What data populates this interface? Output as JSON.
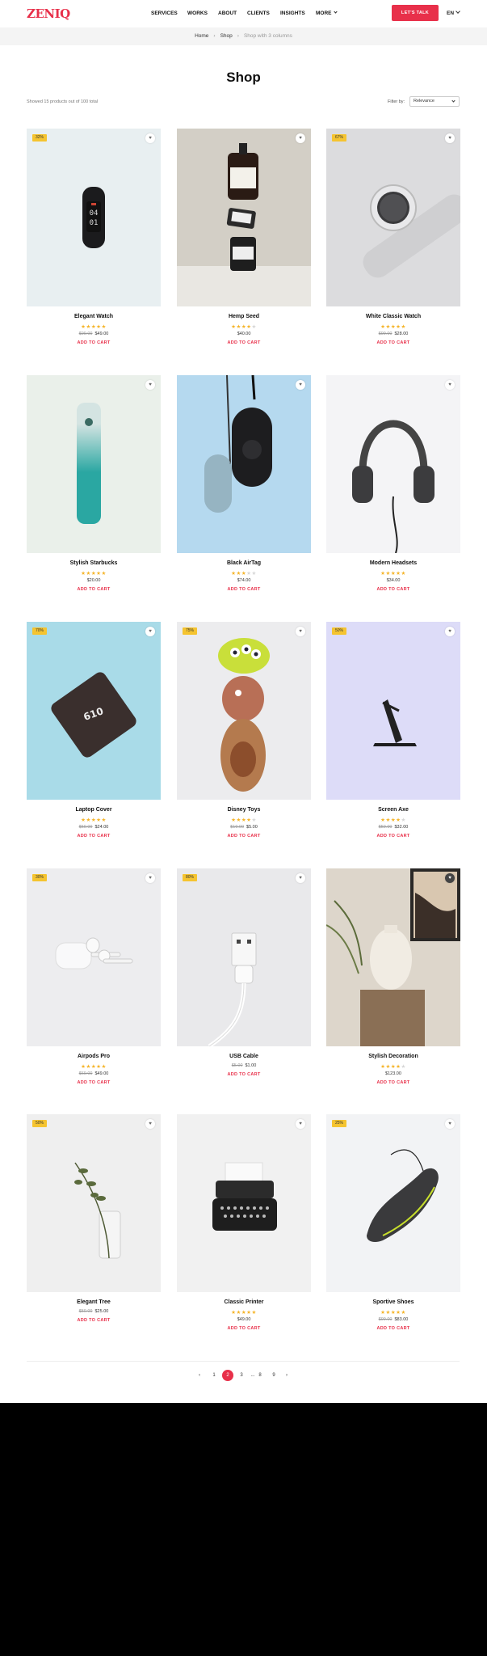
{
  "header": {
    "logo": "ZENIQ",
    "nav": [
      "SERVICES",
      "WORKS",
      "ABOUT",
      "CLIENTS",
      "INSIGHTS",
      "MORE"
    ],
    "cta": "LET'S TALK",
    "lang": "EN"
  },
  "breadcrumb": {
    "home": "Home",
    "shop": "Shop",
    "current": "Shop with 3 columns"
  },
  "page": {
    "title": "Shop",
    "showing": "Showed 15 products out of 100 total",
    "filter_label": "Filter by:",
    "filter_value": "Relevance"
  },
  "products": [
    {
      "name": "Elegant Watch",
      "badge": "32%",
      "rating": 5,
      "old_price": "$99.00",
      "price": "$49.00",
      "cart": "ADD TO CART",
      "bg": "#e8eff1"
    },
    {
      "name": "Hemp Seed",
      "badge": "",
      "rating": 4,
      "old_price": "",
      "price": "$40.00",
      "cart": "ADD TO CART",
      "bg": "#d3cfc6"
    },
    {
      "name": "White Classic Watch",
      "badge": "67%",
      "rating": 5,
      "old_price": "$99.00",
      "price": "$28.00",
      "cart": "ADD TO CART",
      "bg": "#dcdcde"
    },
    {
      "name": "Stylish Starbucks",
      "badge": "",
      "rating": 5,
      "old_price": "",
      "price": "$20.00",
      "cart": "ADD TO CART",
      "bg": "#eaf0ea"
    },
    {
      "name": "Black AirTag",
      "badge": "",
      "rating": 3,
      "old_price": "",
      "price": "$74.00",
      "cart": "ADD TO CART",
      "bg": "#b5d9ef"
    },
    {
      "name": "Modern Headsets",
      "badge": "",
      "rating": 5,
      "old_price": "",
      "price": "$34.00",
      "cart": "ADD TO CART",
      "bg": "#f4f4f6"
    },
    {
      "name": "Laptop Cover",
      "badge": "70%",
      "rating": 5,
      "old_price": "$59.00",
      "price": "$24.00",
      "cart": "ADD TO CART",
      "bg": "#a9dbe8"
    },
    {
      "name": "Disney Toys",
      "badge": "75%",
      "rating": 4,
      "old_price": "$19.00",
      "price": "$5.00",
      "cart": "ADD TO CART",
      "bg": "#ececee"
    },
    {
      "name": "Screen Axe",
      "badge": "50%",
      "rating": 4,
      "old_price": "$59.00",
      "price": "$32.00",
      "cart": "ADD TO CART",
      "bg": "#dddcf8"
    },
    {
      "name": "Airpods Pro",
      "badge": "30%",
      "rating": 5,
      "old_price": "$69.00",
      "price": "$49.00",
      "cart": "ADD TO CART",
      "bg": "#ededef"
    },
    {
      "name": "USB Cable",
      "badge": "80%",
      "rating": 0,
      "old_price": "$5.00",
      "price": "$1.00",
      "cart": "ADD TO CART",
      "bg": "#e9e9eb"
    },
    {
      "name": "Stylish Decoration",
      "badge": "",
      "rating": 4,
      "old_price": "",
      "price": "$123.00",
      "cart": "ADD TO CART",
      "bg": "#ddd6cb"
    },
    {
      "name": "Elegant Tree",
      "badge": "50%",
      "rating": 0,
      "old_price": "$50.00",
      "price": "$25.00",
      "cart": "ADD TO CART",
      "bg": "#efefef"
    },
    {
      "name": "Classic Printer",
      "badge": "",
      "rating": 5,
      "old_price": "",
      "price": "$49.00",
      "cart": "ADD TO CART",
      "bg": "#f1f1f1"
    },
    {
      "name": "Sportive Shoes",
      "badge": "25%",
      "rating": 5,
      "old_price": "$99.00",
      "price": "$83.00",
      "cart": "ADD TO CART",
      "bg": "#f2f3f5"
    }
  ],
  "pagination": {
    "pages": [
      "1",
      "2",
      "3",
      "...",
      "8",
      "9"
    ],
    "active": "2",
    "prev": "‹",
    "next": "›"
  },
  "colors": {
    "accent": "#e8304a",
    "badge": "#f5c430",
    "star": "#f5b428"
  }
}
